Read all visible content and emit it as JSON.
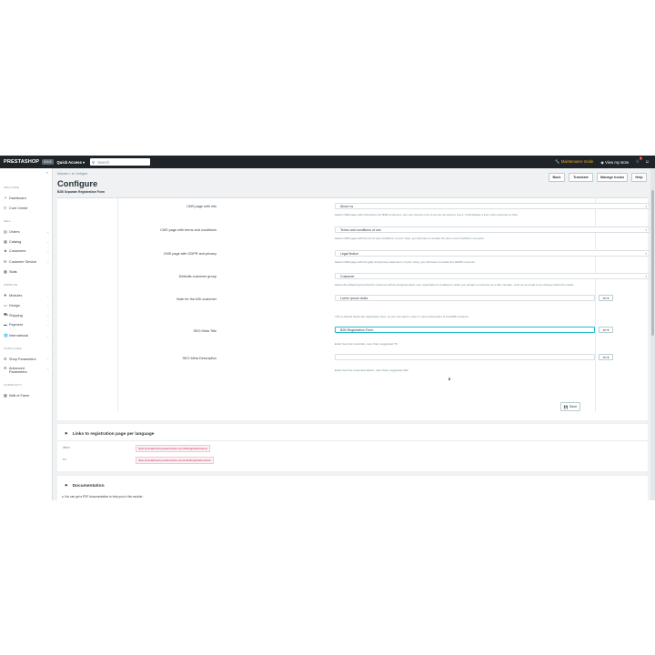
{
  "topbar": {
    "logo": "PRESTASHOP",
    "version": "9.0.0",
    "quick_access": "Quick Access",
    "quick_access_caret": "▾",
    "search_placeholder": "Search",
    "maintenance": "Maintenance mode",
    "view_store": "View my store",
    "notifications_count": "4"
  },
  "sidebar": {
    "sections": [
      "WELCOME",
      "SELL",
      "IMPROVE",
      "CONFIGURE",
      "COMMUNITY"
    ],
    "items": [
      {
        "label": "Dashboard",
        "icon": "trending-icon"
      },
      {
        "label": "Core Center",
        "icon": "cart-icon"
      },
      {
        "label": "Orders",
        "icon": "inbox-icon"
      },
      {
        "label": "Catalog",
        "icon": "store-icon"
      },
      {
        "label": "Customers",
        "icon": "account-icon"
      },
      {
        "label": "Customer Service",
        "icon": "chat-icon"
      },
      {
        "label": "Stats",
        "icon": "bar-chart-icon"
      },
      {
        "label": "Modules",
        "icon": "puzzle-icon"
      },
      {
        "label": "Design",
        "icon": "desktop-icon"
      },
      {
        "label": "Shipping",
        "icon": "truck-icon"
      },
      {
        "label": "Payment",
        "icon": "credit-card-icon"
      },
      {
        "label": "International",
        "icon": "language-icon"
      },
      {
        "label": "Shop Parameters",
        "icon": "settings-icon"
      },
      {
        "label": "Advanced Parameters",
        "icon": "settings-applications-icon"
      },
      {
        "label": "Wall of Fame",
        "icon": "stats-icon"
      }
    ]
  },
  "header": {
    "breadcrumb": "Modules  >  ⚙ Configure",
    "title": "Configure",
    "subtitle": "B2B Separate Registration Form",
    "buttons": {
      "back": "Back",
      "translate": "Translate",
      "manage_hooks": "Manage hooks",
      "help": "Help"
    }
  },
  "form": {
    "fields": [
      {
        "label": "CMS page with info",
        "value": "About us",
        "help": "Select CMS page with instructions for B2B customers, you can choose none if you do not want to use it. It will display a link in the customer to click."
      },
      {
        "label": "CMS page with terms and conditions",
        "value": "Terms and conditions of use",
        "help": "Select CMS page with the terms and conditions of your shop, you will have to enable the terms and conditions consents."
      },
      {
        "label": "CMS page with GDPR and privacy",
        "value": "Legal Notice",
        "help": "Select CMS page with the gdpr and privacy data terms of your shop, you will have to enable the GDPR consents."
      },
      {
        "label": "Defaults customer group",
        "value": "Customer",
        "help": "Select the default group that the customer will be assigned when user registration is enabled or when you accept a customer as a b2b member, such as an email or by clicking check from table."
      },
      {
        "label": "Note for the b2b customer",
        "value": "Lorem ipsum dollor",
        "lang": "en ▾",
        "help": "This is placed below the registration form, so you can pass a note or some information to the B2B customer."
      },
      {
        "label": "SEO Meta Title",
        "value": "B2B Registration Form",
        "lang": "en ▾",
        "help": "Enter here the meta title, max chars suggested 70."
      },
      {
        "label": "SEO Meta Description",
        "value": "",
        "lang": "en ▾",
        "help": "Enter here the meta description, max chars suggested 160."
      }
    ],
    "save": "Save"
  },
  "links_panel": {
    "title": "Links to registration page per language",
    "rows": [
      {
        "lang": "demo",
        "url": "https://prestashop9.prestamodules.com/b2bregistration/demo"
      },
      {
        "lang": "en",
        "url": "https://prestashop9.prestamodules.com/en/b2bregistration/demo"
      }
    ]
  },
  "doc_panel": {
    "title": "Documentation",
    "text": "● You can get a PDF documentation to help you in this module :"
  }
}
